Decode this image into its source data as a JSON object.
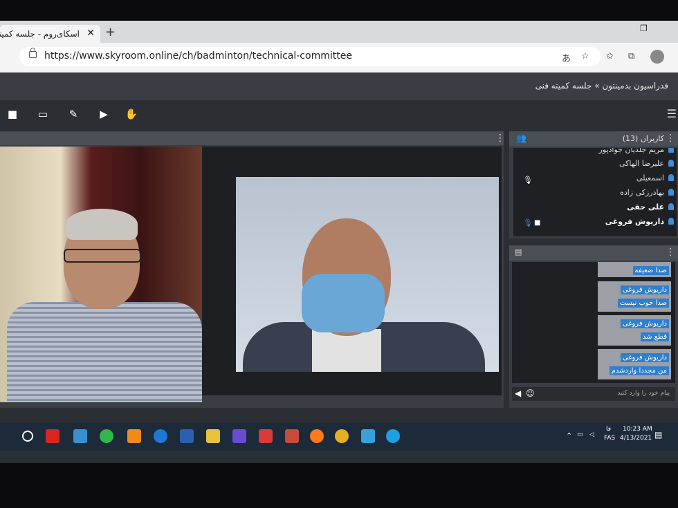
{
  "browser": {
    "tab_title": "اسکای‌روم - جلسه کمیته فنی",
    "tab_close": "✕",
    "new_tab": "+",
    "url": "https://www.skyroom.online/ch/badminton/technical-committee"
  },
  "app": {
    "breadcrumb": "فدراسیون بدمینتون » جلسه کمیته فنی"
  },
  "users": {
    "title": "کاربران (13)",
    "items": [
      {
        "name": "مریم جلدیان جوادپور"
      },
      {
        "name": "علیرضا الهاکی"
      },
      {
        "name": "اسمعیلی"
      },
      {
        "name": "بهادرزکی زاده"
      },
      {
        "name": "علی حقی"
      },
      {
        "name": "داریوش فروغی"
      }
    ]
  },
  "chat": {
    "messages": [
      {
        "sender": "",
        "text": "صدا ضعیفه"
      },
      {
        "sender": "داریوش فروغی",
        "text": "صدا خوب نیست"
      },
      {
        "sender": "داریوش فروغی",
        "text": "قطع شد"
      },
      {
        "sender": "داریوش فروغی",
        "text": "من مجددا واردشدم"
      }
    ],
    "input_placeholder": "پیام خود را وارد کنید"
  },
  "taskbar": {
    "lang_short": "فا",
    "lang": "FAS",
    "time": "10:23 AM",
    "date": "4/13/2021"
  },
  "colors": {
    "accent": "#2f7fd0",
    "panel": "#3a3e44",
    "taskbar": "#1c2a3a"
  }
}
